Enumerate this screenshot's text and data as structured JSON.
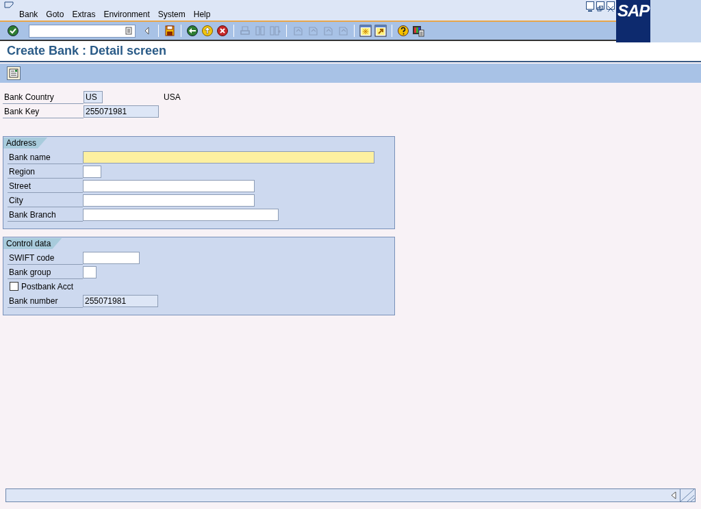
{
  "menu": [
    {
      "label": "Bank"
    },
    {
      "label": "Goto"
    },
    {
      "label": "Extras"
    },
    {
      "label": "Environment"
    },
    {
      "label": "System"
    },
    {
      "label": "Help"
    }
  ],
  "logo": "SAP",
  "toolbar": [
    {
      "kind": "enter",
      "disabled": false
    },
    {
      "kind": "command"
    },
    {
      "kind": "sep"
    },
    {
      "kind": "save",
      "disabled": false
    },
    {
      "kind": "sep"
    },
    {
      "kind": "back",
      "disabled": false
    },
    {
      "kind": "exit",
      "disabled": false
    },
    {
      "kind": "cancel",
      "disabled": false
    },
    {
      "kind": "sep"
    },
    {
      "kind": "print",
      "disabled": true
    },
    {
      "kind": "find",
      "disabled": true
    },
    {
      "kind": "findnext",
      "disabled": true
    },
    {
      "kind": "sep"
    },
    {
      "kind": "page",
      "disabled": true
    },
    {
      "kind": "page",
      "disabled": true
    },
    {
      "kind": "page",
      "disabled": true
    },
    {
      "kind": "page",
      "disabled": true
    },
    {
      "kind": "sep"
    },
    {
      "kind": "session",
      "disabled": false
    },
    {
      "kind": "shortcut",
      "disabled": false
    },
    {
      "kind": "sep"
    },
    {
      "kind": "help",
      "disabled": false
    },
    {
      "kind": "layout",
      "disabled": false
    }
  ],
  "title": "Create Bank : Detail screen",
  "header_fields": [
    {
      "kind": "display",
      "label": "Bank Country",
      "value": "US",
      "description": "USA"
    },
    {
      "kind": "display",
      "label": "Bank Key",
      "value": "255071981"
    }
  ],
  "groups": [
    {
      "title": "Address",
      "fields": [
        {
          "kind": "input",
          "label": "Bank name",
          "focused": true
        },
        {
          "kind": "input",
          "label": "Region",
          "focused": false
        },
        {
          "kind": "input",
          "label": "Street",
          "focused": false
        },
        {
          "kind": "input",
          "label": "City",
          "focused": false
        },
        {
          "kind": "input",
          "label": "Bank Branch",
          "focused": false
        }
      ]
    },
    {
      "title": "Control data",
      "fields": [
        {
          "kind": "input",
          "label": "SWIFT code",
          "focused": false
        },
        {
          "kind": "input",
          "label": "Bank group",
          "focused": false
        },
        {
          "kind": "checkbox",
          "label": "Postbank Acct",
          "checked": false
        },
        {
          "kind": "display",
          "label": "Bank number",
          "value": "255071981"
        }
      ]
    }
  ]
}
